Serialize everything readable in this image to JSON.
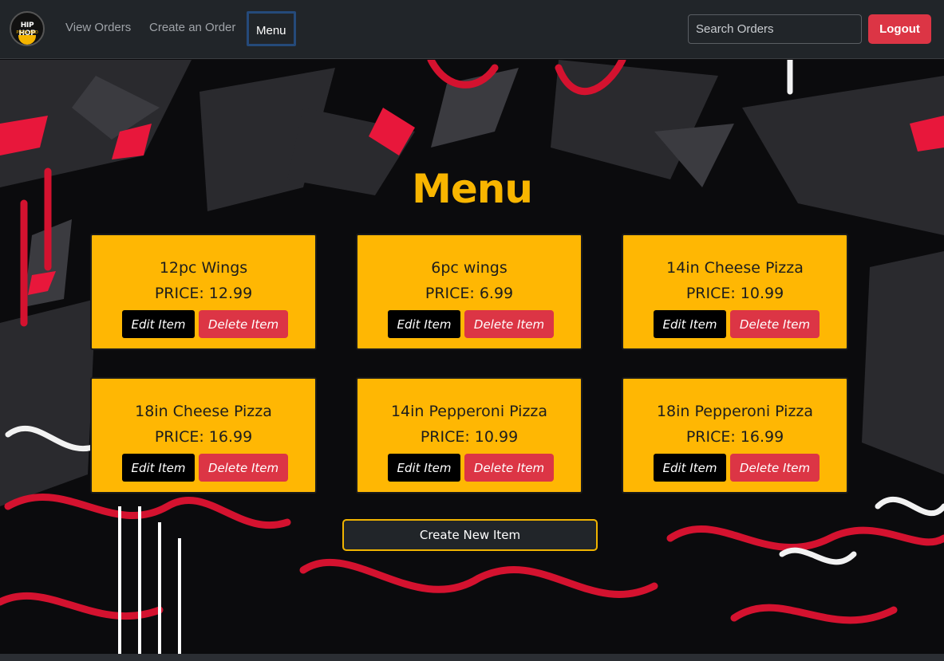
{
  "nav": {
    "logo": {
      "top": "HIP HOP",
      "sub": "PIZZA AND WINGS"
    },
    "links": [
      "View Orders",
      "Create an Order",
      "Menu"
    ],
    "active_link": "Menu",
    "search_placeholder": "Search Orders",
    "logout_label": "Logout"
  },
  "page": {
    "title": "Menu",
    "edit_label": "Edit Item",
    "delete_label": "Delete Item",
    "create_label": "Create New Item"
  },
  "items": [
    {
      "name": "12pc Wings",
      "price": "PRICE: 12.99"
    },
    {
      "name": "6pc wings",
      "price": "PRICE: 6.99"
    },
    {
      "name": "14in Cheese Pizza",
      "price": "PRICE: 10.99"
    },
    {
      "name": "18in Cheese Pizza",
      "price": "PRICE: 16.99"
    },
    {
      "name": "14in Pepperoni Pizza",
      "price": "PRICE: 10.99"
    },
    {
      "name": "18in Pepperoni Pizza",
      "price": "PRICE: 16.99"
    }
  ],
  "colors": {
    "accent": "#ffb703",
    "danger": "#dc3545",
    "navbar": "#212529"
  }
}
